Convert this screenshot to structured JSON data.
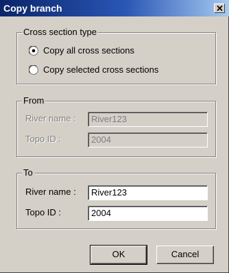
{
  "window": {
    "title": "Copy branch"
  },
  "cross_section_group": {
    "legend": "Cross section type",
    "options": [
      {
        "label": "Copy all cross sections",
        "checked": true
      },
      {
        "label": "Copy selected cross sections",
        "checked": false
      }
    ]
  },
  "from_group": {
    "legend": "From",
    "river_label": "River name :",
    "river_value": "River123",
    "topo_label": "Topo ID :",
    "topo_value": "2004"
  },
  "to_group": {
    "legend": "To",
    "river_label": "River name :",
    "river_value": "River123",
    "topo_label": "Topo ID :",
    "topo_value": "2004"
  },
  "buttons": {
    "ok": "OK",
    "cancel": "Cancel"
  }
}
